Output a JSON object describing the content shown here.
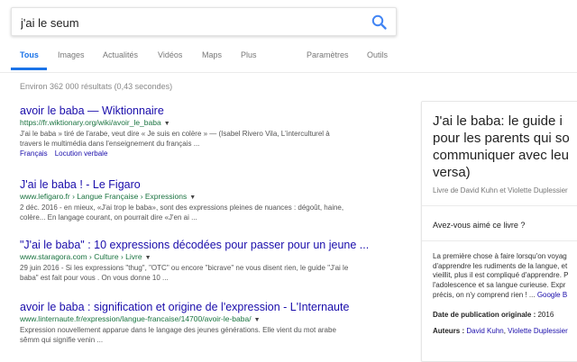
{
  "search": {
    "query": "j'ai le seum"
  },
  "tabs": [
    {
      "label": "Tous"
    },
    {
      "label": "Images"
    },
    {
      "label": "Actualités"
    },
    {
      "label": "Vidéos"
    },
    {
      "label": "Maps"
    },
    {
      "label": "Plus"
    },
    {
      "label": "Paramètres"
    },
    {
      "label": "Outils"
    }
  ],
  "stats": "Environ 362 000 résultats (0,43 secondes)",
  "results": [
    {
      "title": "avoir le baba — Wiktionnaire",
      "url": "https://fr.wiktionary.org/wiki/avoir_le_baba",
      "snippet_line1": "J'ai le baba » tiré de l'arabe, veut dire « Je suis en colère » — (Isabel Rivero Vila, L'interculturel à",
      "snippet_line2": "travers le multimédia dans l'enseignement du français ...",
      "sitelinks": [
        "Français",
        "Locution verbale"
      ]
    },
    {
      "title": "J'ai le baba ! - Le Figaro",
      "url": "www.lefigaro.fr › Langue Française › Expressions",
      "snippet_line1": "2 déc. 2016 - en mieux, «J'ai trop le baba», sont des expressions pleines de nuances : dégoût, haine,",
      "snippet_line2": "colère... En langage courant, on pourrait dire «J'en ai ..."
    },
    {
      "title": "\"J'ai le baba\" : 10 expressions décodées pour passer pour un jeune ...",
      "url": "www.staragora.com › Culture › Livre",
      "snippet_line1": "29 juin 2016 - Si les expressions \"thug\", \"OTC\" ou encore \"bicrave\" ne vous disent rien, le guide \"J'ai le",
      "snippet_line2": "baba\" est fait pour vous . On vous donne 10 ..."
    },
    {
      "title": "avoir le baba : signification et origine de l'expression - L'Internaute",
      "url": "www.linternaute.fr/expression/langue-francaise/14700/avoir-le-baba/",
      "snippet_line1": "Expression nouvellement apparue dans le langage des jeunes générations. Elle vient du mot arabe",
      "snippet_line2": "sêmm qui signifie venin ..."
    }
  ],
  "panel": {
    "title_lines": [
      "J'ai le baba: le guide i",
      "pour les parents qui so",
      "communiquer avec leu",
      "versa)"
    ],
    "subtitle": "Livre de David Kuhn et Violette Duplessier",
    "question": "Avez-vous aimé ce livre ?",
    "description_lines": [
      "La première chose à faire lorsqu'on voyag",
      "d'apprendre les rudiments de la langue, et",
      "vieillit, plus il est compliqué d'apprendre. P",
      "l'adolescence et sa langue curieuse. Expr",
      "précis, on n'y comprend rien ! ..."
    ],
    "description_link": "Google B",
    "pub_label": "Date de publication originale :",
    "pub_value": "2016",
    "authors_label": "Auteurs :",
    "authors": [
      "David Kuhn",
      "Violette Duplessier"
    ]
  },
  "colors": {
    "link": "#1a0dab",
    "url": "#1a7340",
    "accent": "#1a73e8"
  },
  "icons": {
    "search": "search-icon",
    "dropdown": "dropdown-arrow-icon"
  }
}
